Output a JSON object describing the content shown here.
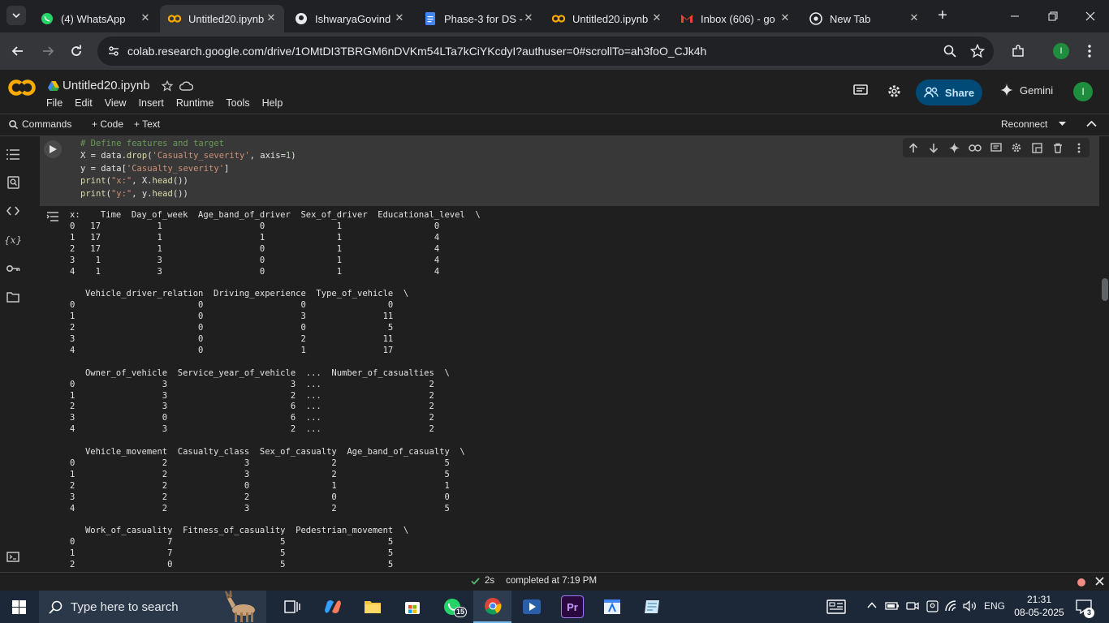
{
  "browser": {
    "tabs": [
      {
        "title": "(4) WhatsApp",
        "icon": "whatsapp-icon",
        "active": false
      },
      {
        "title": "Untitled20.ipynb",
        "icon": "colab-icon",
        "active": true
      },
      {
        "title": "IshwaryaGovind",
        "icon": "github-icon",
        "active": false
      },
      {
        "title": "Phase-3 for DS -",
        "icon": "docs-icon",
        "active": false
      },
      {
        "title": "Untitled20.ipynb",
        "icon": "colab-icon",
        "active": false
      },
      {
        "title": "Inbox (606) - go",
        "icon": "gmail-icon",
        "active": false
      },
      {
        "title": "New Tab",
        "icon": "chrome-icon",
        "active": false
      }
    ],
    "url": "colab.research.google.com/drive/1OMtDI3TBRGM6nDVKm54LTa7kCiYKcdyI?authuser=0#scrollTo=ah3foO_CJk4h",
    "profile_initial": "I"
  },
  "colab": {
    "notebook_title": "Untitled20.ipynb",
    "menu": [
      "File",
      "Edit",
      "View",
      "Insert",
      "Runtime",
      "Tools",
      "Help"
    ],
    "share_label": "Share",
    "gemini_label": "Gemini",
    "profile_initial": "I",
    "toolbar": {
      "commands_label": "Commands",
      "code_label": "+ Code",
      "text_label": "+ Text",
      "reconnect_label": "Reconnect"
    }
  },
  "cell": {
    "code_lines": [
      "# Define features and target",
      "X = data.drop('Casualty_severity', axis=1)",
      "y = data['Casualty_severity']",
      "print(\"x:\", X.head())",
      "print(\"y:\", y.head())"
    ],
    "output": "x:    Time  Day_of_week  Age_band_of_driver  Sex_of_driver  Educational_level  \\\n0   17           1                   0              1                  0   \n1   17           1                   1              1                  4   \n2   17           1                   0              1                  4   \n3    1           3                   0              1                  4   \n4    1           3                   0              1                  4   \n\n   Vehicle_driver_relation  Driving_experience  Type_of_vehicle  \\\n0                        0                   0                0   \n1                        0                   3               11   \n2                        0                   0                5   \n3                        0                   2               11   \n4                        0                   1               17   \n\n   Owner_of_vehicle  Service_year_of_vehicle  ...  Number_of_casualties  \\\n0                 3                        3  ...                     2   \n1                 3                        2  ...                     2   \n2                 3                        6  ...                     2   \n3                 0                        6  ...                     2   \n4                 3                        2  ...                     2   \n\n   Vehicle_movement  Casualty_class  Sex_of_casualty  Age_band_of_casualty  \\\n0                 2               3                2                     5   \n1                 2               3                2                     5   \n2                 2               0                1                     1   \n3                 2               2                0                     0   \n4                 2               3                2                     5   \n\n   Work_of_casuality  Fitness_of_casuality  Pedestrian_movement  \\\n0                  7                     5                    5   \n1                  7                     5                    5   \n2                  0                     5                    5   "
  },
  "status": {
    "duration": "2s",
    "completed": "completed at 7:19 PM"
  },
  "taskbar": {
    "search_placeholder": "Type here to search",
    "whatsapp_badge": "15",
    "language": "ENG",
    "time": "21:31",
    "date": "08-05-2025",
    "notification_count": "3"
  }
}
